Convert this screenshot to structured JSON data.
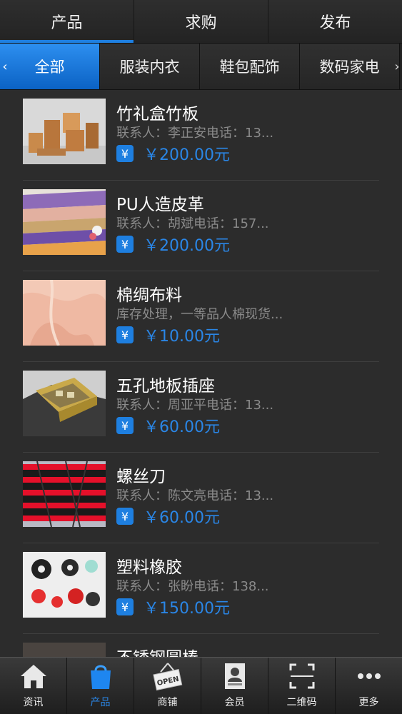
{
  "top_tabs": [
    {
      "label": "产品",
      "active": true
    },
    {
      "label": "求购",
      "active": false
    },
    {
      "label": "发布",
      "active": false
    }
  ],
  "categories": {
    "left_arrow": "‹",
    "right_arrow": "›",
    "items": [
      {
        "label": "全部",
        "active": true
      },
      {
        "label": "服装内衣",
        "active": false
      },
      {
        "label": "鞋包配饰",
        "active": false
      },
      {
        "label": "数码家电",
        "active": false
      }
    ]
  },
  "products": [
    {
      "title": "竹礼盒竹板",
      "desc": "联系人：李正安电话：13...",
      "price": "￥200.00元",
      "image": "bamboo-boxes"
    },
    {
      "title": "PU人造皮革",
      "desc": "联系人：胡斌电话：157...",
      "price": "￥200.00元",
      "image": "leather-rolls"
    },
    {
      "title": "棉绸布料",
      "desc": "库存处理，一等品人棉现货...",
      "price": "￥10.00元",
      "image": "fabric-pink"
    },
    {
      "title": "五孔地板插座",
      "desc": "联系人：周亚平电话：13...",
      "price": "￥60.00元",
      "image": "floor-socket"
    },
    {
      "title": "螺丝刀",
      "desc": "联系人：陈文亮电话：13...",
      "price": "￥60.00元",
      "image": "screwdrivers"
    },
    {
      "title": "塑料橡胶",
      "desc": "联系人：张盼电话：138...",
      "price": "￥150.00元",
      "image": "plastic-parts"
    },
    {
      "title": "不锈钢圆棒",
      "desc": "",
      "price": "",
      "image": "steel-rod"
    }
  ],
  "yen_badge": "¥",
  "bottom_nav": [
    {
      "label": "资讯",
      "icon": "home-icon",
      "active": false
    },
    {
      "label": "产品",
      "icon": "bag-icon",
      "active": true
    },
    {
      "label": "商铺",
      "icon": "open-sign-icon",
      "active": false,
      "icon_text": "OPEN"
    },
    {
      "label": "会员",
      "icon": "member-card-icon",
      "active": false
    },
    {
      "label": "二维码",
      "icon": "qr-scan-icon",
      "active": false
    },
    {
      "label": "更多",
      "icon": "more-dots-icon",
      "active": false
    }
  ],
  "colors": {
    "accent": "#1e7fe0",
    "price": "#2a86e6",
    "background": "#2c2c2c",
    "desc": "#8a8a8a"
  }
}
